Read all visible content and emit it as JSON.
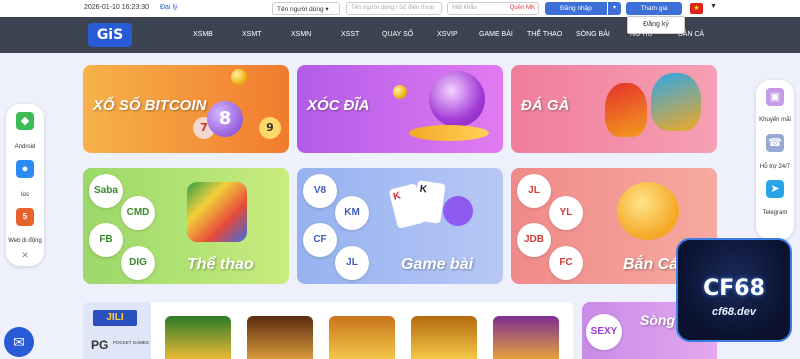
{
  "topbar": {
    "datetime": "2026-01-10 16:23:30",
    "agent_link": "Đại lý",
    "user_type_select": "Tên người dùng",
    "username_placeholder": "Tên người dùng / Số điện thoại",
    "password_placeholder": "Mật khẩu",
    "forgot_label": "Quên MK",
    "login_button": "Đăng nhập",
    "join_button": "Tham gia",
    "register_option": "Đăng ký"
  },
  "nav": {
    "logo": "GiS",
    "items": [
      "XSMB",
      "XSMT",
      "XSMN",
      "XSST",
      "QUAY SỐ",
      "XSVIP",
      "GAME BÀI",
      "THỂ THAO",
      "SÒNG BÀI",
      "NỔ HŨ",
      "BẮN CÁ"
    ]
  },
  "cards": {
    "lottery": "XỔ SỐ BITCOIN",
    "xocdia": "XÓC ĐĨA",
    "cockfight": "ĐÁ GÀ",
    "sports": {
      "title": "Thể thao",
      "providers": [
        "Saba",
        "CMD",
        "FB",
        "DIG"
      ]
    },
    "cardgames": {
      "title": "Game bài",
      "providers": [
        "V8",
        "KM",
        "CF",
        "JL"
      ]
    },
    "fishing": {
      "title": "Bắn Cá",
      "providers": [
        "JL",
        "YL",
        "JDB",
        "FC"
      ]
    },
    "casino": {
      "title": "Sòng Bài",
      "providers": [
        "SEXY"
      ]
    }
  },
  "slots": {
    "jili": "JILI",
    "pg": "PG",
    "pg_sub": "POCKET GAMES"
  },
  "left_panel": {
    "items": [
      "Android",
      "Ios",
      "Web di động"
    ]
  },
  "right_panel": {
    "items": [
      "Khuyến mãi",
      "Hỗ trợ 24/7",
      "Telegram"
    ]
  },
  "brand": {
    "name": "CF68",
    "url": "cf68.dev"
  },
  "ball_numbers": [
    "7",
    "8",
    "9"
  ],
  "colors": {
    "accent": "#3d6fd8",
    "nav_bg": "#3d4451"
  }
}
